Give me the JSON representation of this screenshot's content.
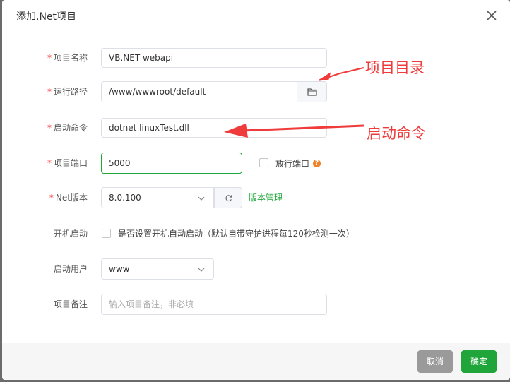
{
  "dialog": {
    "title": "添加.Net项目"
  },
  "form": {
    "project_name": {
      "label": "项目名称",
      "value": "VB.NET webapi"
    },
    "run_path": {
      "label": "运行路径",
      "value": "/www/wwwroot/default"
    },
    "start_cmd": {
      "label": "启动命令",
      "value": "dotnet linuxTest.dll"
    },
    "port": {
      "label": "项目端口",
      "value": "5000",
      "open_port_label": "放行端口"
    },
    "net_version": {
      "label": "Net版本",
      "value": "8.0.100",
      "manage_link": "版本管理"
    },
    "autostart": {
      "label": "开机启动",
      "text": "是否设置开机自动启动（默认自带守护进程每120秒检测一次）"
    },
    "run_user": {
      "label": "启动用户",
      "value": "www"
    },
    "remark": {
      "label": "项目备注",
      "placeholder": "输入项目备注，非必填"
    }
  },
  "annotations": {
    "dir": "项目目录",
    "cmd": "启动命令"
  },
  "footer": {
    "cancel": "取消",
    "confirm": "确定"
  },
  "colors": {
    "accent": "#20a53a",
    "required": "#ef4444",
    "annotation": "#ef3b3b"
  }
}
